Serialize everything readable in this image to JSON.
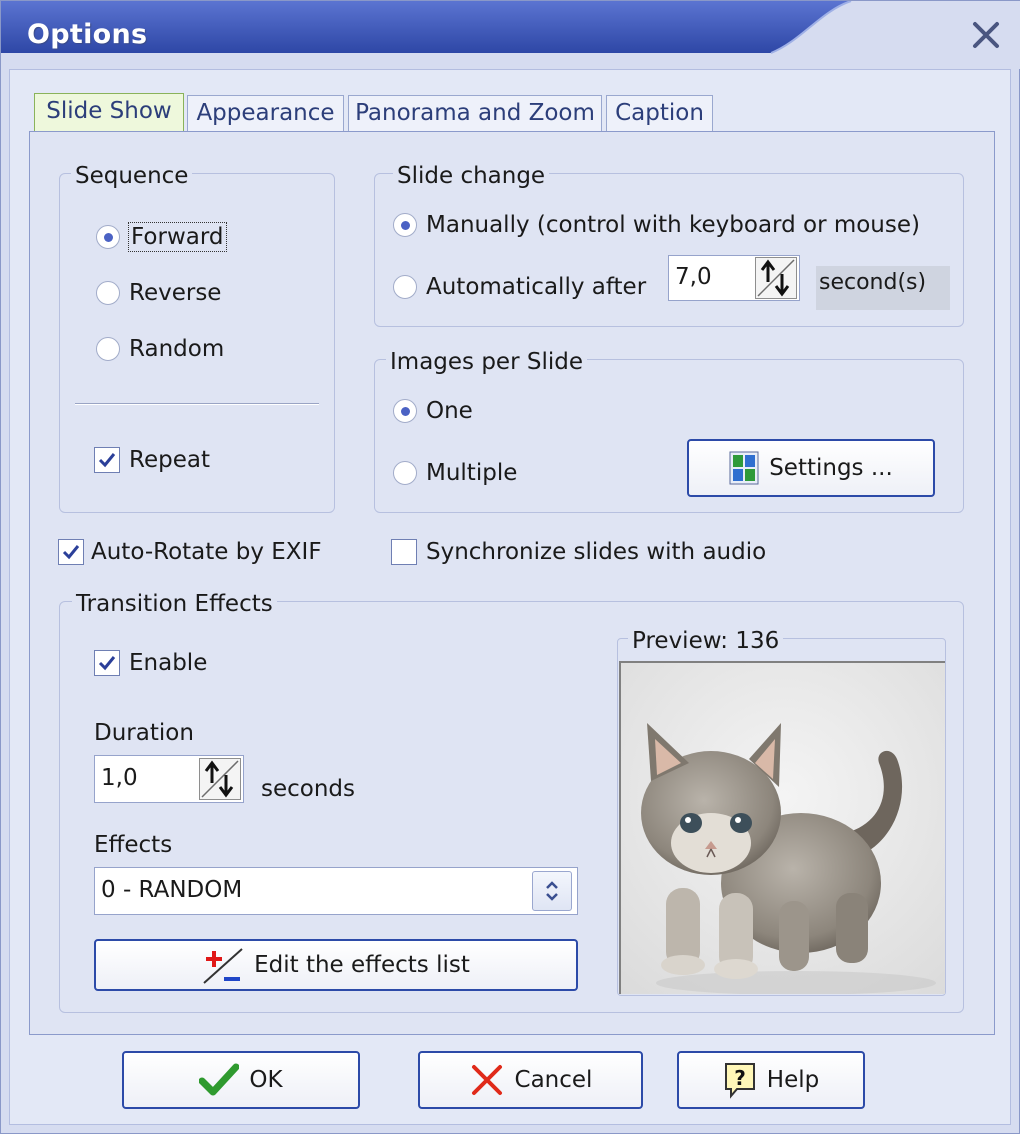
{
  "window": {
    "title": "Options"
  },
  "tabs": [
    {
      "label": "Slide Show",
      "active": true
    },
    {
      "label": "Appearance",
      "active": false
    },
    {
      "label": "Panorama and Zoom",
      "active": false
    },
    {
      "label": "Caption",
      "active": false
    }
  ],
  "sequence": {
    "title": "Sequence",
    "options": [
      "Forward",
      "Reverse",
      "Random"
    ],
    "selected": "Forward",
    "repeat_label": "Repeat",
    "repeat_checked": true
  },
  "slide_change": {
    "title": "Slide change",
    "manual_label": "Manually (control with keyboard or mouse)",
    "auto_label": "Automatically after",
    "auto_value": "7,0",
    "unit": "second(s)",
    "selected": "manual"
  },
  "images_per_slide": {
    "title": "Images per Slide",
    "one_label": "One",
    "multiple_label": "Multiple",
    "selected": "one",
    "settings_label": "Settings ..."
  },
  "auto_rotate": {
    "label": "Auto-Rotate by EXIF",
    "checked": true
  },
  "sync_audio": {
    "label": "Synchronize slides with audio",
    "checked": false
  },
  "transition": {
    "title": "Transition Effects",
    "enable_label": "Enable",
    "enable_checked": true,
    "duration_label": "Duration",
    "duration_value": "1,0",
    "duration_unit": "seconds",
    "effects_label": "Effects",
    "effects_selected": "0 - RANDOM",
    "edit_list_label": "Edit the effects list",
    "preview_title": "Preview: 136"
  },
  "buttons": {
    "ok": "OK",
    "cancel": "Cancel",
    "help": "Help"
  },
  "colors": {
    "title_bar": "#3d57b8",
    "accent": "#2c4aa8",
    "tab_active": "#eef8dc"
  }
}
